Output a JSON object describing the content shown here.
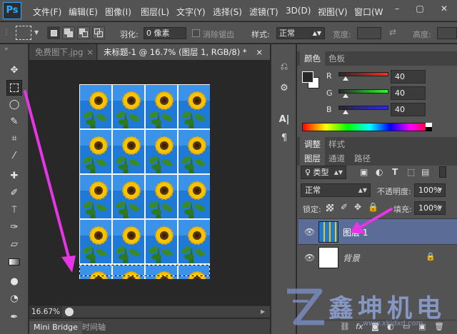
{
  "app": {
    "logo": "Ps"
  },
  "menu": [
    "文件(F)",
    "编辑(E)",
    "图像(I)",
    "图层(L)",
    "文字(Y)",
    "选择(S)",
    "滤镜(T)",
    "3D(D)",
    "视图(V)",
    "窗口(W"
  ],
  "window_controls": [
    "–",
    "▢",
    "✕"
  ],
  "options": {
    "feather_label": "羽化:",
    "feather_value": "0 像素",
    "antialias_label": "消除锯齿",
    "style_label": "样式:",
    "style_value": "正常",
    "width_label": "宽度:",
    "height_label": "高度:"
  },
  "tabs": {
    "doc1": "免费图下.jpg",
    "doc1_close": "×",
    "doc2": "未标题-1 @ 16.7% (图层 1, RGB/8) *",
    "doc2_close": "×"
  },
  "status": {
    "zoom": "16.67%"
  },
  "bottom_tabs": {
    "mini_bridge": "Mini Bridge",
    "timeline": "时间轴"
  },
  "color_panel": {
    "tabs": [
      "颜色",
      "色板"
    ],
    "channels": [
      {
        "label": "R",
        "value": "40",
        "color": "#d93030"
      },
      {
        "label": "G",
        "value": "40",
        "color": "#2fb52f"
      },
      {
        "label": "B",
        "value": "40",
        "color": "#3a3ae0"
      }
    ]
  },
  "adjust_panel": {
    "tabs": [
      "调整",
      "样式"
    ]
  },
  "layers_panel": {
    "tabs": [
      "图层",
      "通道",
      "路径"
    ],
    "filter_label": "♀ 类型",
    "blend_mode": "正常",
    "opacity_label": "不透明度:",
    "opacity_value": "100%",
    "lock_label": "锁定:",
    "fill_label": "填充:",
    "fill_value": "100%",
    "layers": [
      {
        "name": "图层 1",
        "selected": true
      },
      {
        "name": "背景",
        "selected": false
      }
    ]
  },
  "icons": {
    "move": "✥",
    "marquee": "⬚",
    "lasso": "◯",
    "quick_select": "✎",
    "crop": "⌗",
    "eyedropper": "⁄",
    "heal": "✚",
    "brush": "✐",
    "stamp": "⍑",
    "history": "✑",
    "eraser": "▱",
    "gradient": "▭",
    "blur": "●",
    "dodge": "◔",
    "pen": "✒"
  },
  "watermark": {
    "text": "鑫坤机电",
    "url": "www.xkjdxd.com"
  },
  "colors": {
    "accent": "#e535e5",
    "selection": "#5b6d96",
    "photo_sky": "#1e7ad6"
  }
}
